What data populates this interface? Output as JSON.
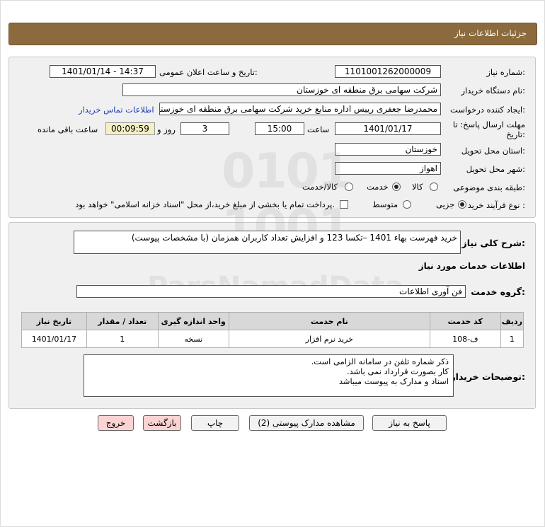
{
  "header": {
    "title": "جزئیات اطلاعات نیاز"
  },
  "fields": {
    "need_number_label": "شماره نیاز:",
    "need_number": "1101001262000009",
    "announce_label": "تاریخ و ساعت اعلان عمومی:",
    "announce_value": "1401/01/14 - 14:37",
    "buyer_org_label": "نام دستگاه خریدار:",
    "buyer_org": "شرکت سهامی برق منطقه ای خوزستان",
    "requester_label": "ایجاد کننده درخواست:",
    "requester": "محمدرضا جعفری رییس اداره منابع خرید شرکت سهامی برق منطقه ای خوزستان",
    "contact_link": "اطلاعات تماس خریدار",
    "deadline_label": "مهلت ارسال پاسخ: تا",
    "deadline_label2": "تاریخ:",
    "deadline_date": "1401/01/17",
    "time_label": "ساعت",
    "deadline_time": "15:00",
    "days_value": "3",
    "days_label": "روز و",
    "remaining_value": "00:09:59",
    "remaining_label": "ساعت باقی مانده",
    "province_label": "استان محل تحویل:",
    "province": "خوزستان",
    "city_label": "شهر محل تحویل:",
    "city": "اهواز",
    "category_label": "طبقه بندی موضوعی:",
    "category_options": [
      "کالا",
      "خدمت",
      "کالا/خدمت"
    ],
    "category_selected": "خدمت",
    "process_label": "نوع فرآیند خرید :",
    "process_options": [
      "جزیی",
      "متوسط"
    ],
    "process_selected": "جزیی",
    "payment_text": "پرداخت تمام یا بخشی از مبلغ خرید،از محل \"اسناد خزانه اسلامی\" خواهد بود."
  },
  "details": {
    "general_desc_label": "شرح کلی نیاز:",
    "general_desc": "خرید فهرست بهاء 1401 –تکسا 123 و افزایش تعداد کاربران همزمان (با مشخصات پیوست)",
    "services_title": "اطلاعات خدمات مورد نیاز",
    "service_group_label": "گروه خدمت:",
    "service_group": "فن آوری اطلاعات",
    "table": {
      "headers": [
        "ردیف",
        "کد خدمت",
        "نام خدمت",
        "واحد اندازه گیری",
        "تعداد / مقدار",
        "تاریخ نیاز"
      ],
      "rows": [
        [
          "1",
          "ف-108",
          "خرید نرم افزار",
          "نسخه",
          "1",
          "1401/01/17"
        ]
      ]
    },
    "buyer_notes_label": "توضیحات خریدار:",
    "buyer_notes": [
      "ذکر شماره تلفن در سامانه الزامی است.",
      "کار بصورت قرارداد نمی باشد.",
      "اسناد و مدارک به پیوست میباشد"
    ]
  },
  "buttons": {
    "reply": "پاسخ به نیاز",
    "attachments": "مشاهده مدارک پیوستی (2)",
    "print": "چاپ",
    "back": "بازگشت",
    "exit": "خروج"
  }
}
